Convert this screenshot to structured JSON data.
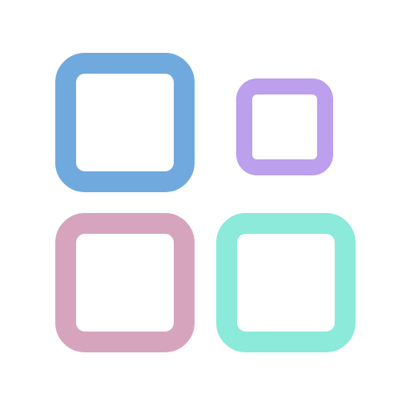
{
  "icon": {
    "name": "app-grid-icon",
    "tiles": [
      {
        "name": "tile-top-left",
        "color": "#70A9DD"
      },
      {
        "name": "tile-top-right-small",
        "color": "#BC9FED"
      },
      {
        "name": "tile-bottom-left",
        "color": "#D6A5BD"
      },
      {
        "name": "tile-bottom-right",
        "color": "#8BEAD9"
      }
    ]
  }
}
